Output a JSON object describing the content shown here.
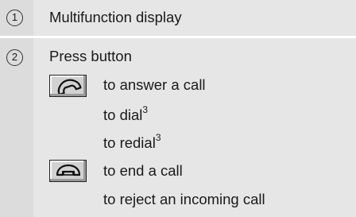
{
  "items": [
    {
      "number": "1",
      "label": "Multifunction display"
    },
    {
      "number": "2",
      "label": "Press button",
      "answer_button": {
        "icon": "phone-answer-icon",
        "actions": [
          {
            "text": "to answer a call",
            "sup": ""
          },
          {
            "text": "to dial",
            "sup": "3"
          },
          {
            "text": "to redial",
            "sup": "3"
          }
        ]
      },
      "end_button": {
        "icon": "phone-end-icon",
        "actions": [
          {
            "text": "to end a call",
            "sup": ""
          },
          {
            "text": "to reject an incoming call",
            "sup": ""
          }
        ]
      }
    }
  ]
}
